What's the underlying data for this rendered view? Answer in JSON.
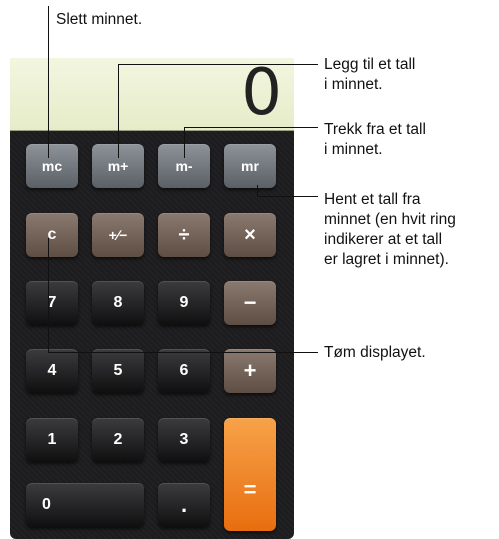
{
  "display": {
    "value": "0"
  },
  "buttons": {
    "mc": "mc",
    "mplus": "m+",
    "mminus": "m-",
    "mr": "mr",
    "clear": "c",
    "sign": "+∕−",
    "divide": "÷",
    "multiply": "×",
    "seven": "7",
    "eight": "8",
    "nine": "9",
    "minus": "−",
    "four": "4",
    "five": "5",
    "six": "6",
    "plus": "+",
    "one": "1",
    "two": "2",
    "three": "3",
    "zero": "0",
    "dot": ".",
    "equals": "="
  },
  "callouts": {
    "clear_memory": "Slett minnet.",
    "add_memory": "Legg til et tall\ni minnet.",
    "subtract_memory": "Trekk fra et tall\ni minnet.",
    "recall_memory": "Hent et tall fra\nminnet (en hvit ring\nindikerer at et tall\ner lagret i minnet).",
    "clear_display": "Tøm displayet."
  },
  "colors": {
    "display": "#eef2d6",
    "memory_key": "#6f757b",
    "operator_key": "#6f5e53",
    "number_key": "#1b1b1c",
    "equals_key": "#f08a2a"
  }
}
